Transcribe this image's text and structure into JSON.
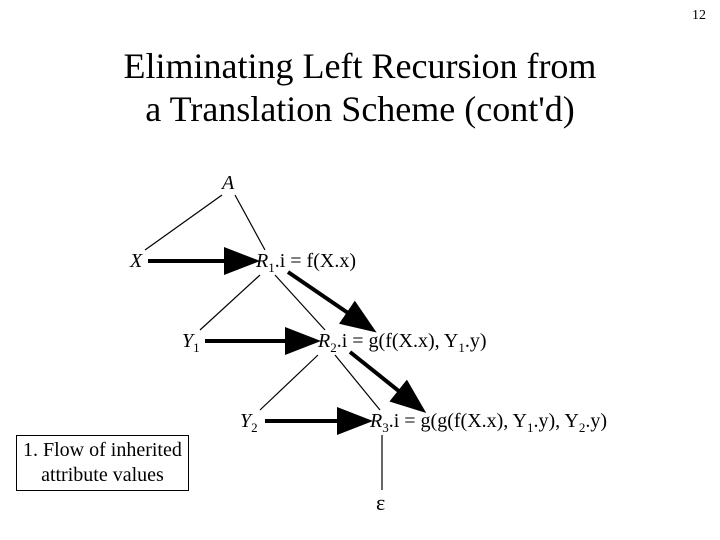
{
  "page_number": "12",
  "title_line1": "Eliminating Left Recursion from",
  "title_line2": "a Translation Scheme (cont'd)",
  "nodes": {
    "A": "A",
    "X": "X",
    "R1_prefix": "R",
    "R1_sub": "1",
    "R1_rest": ".i = f(X.x)",
    "Y1_prefix": "Y",
    "Y1_sub": "1",
    "R2_prefix": "R",
    "R2_sub": "2",
    "R2_mid1": ".i = g(f(X.x), Y",
    "R2_sub2": "1",
    "R2_rest": ".y)",
    "Y2_prefix": "Y",
    "Y2_sub": "2",
    "R3_prefix": "R",
    "R3_sub": "3",
    "R3_mid1": ".i = g(g(f(X.x), Y",
    "R3_sub2": "1",
    "R3_mid2": ".y), Y",
    "R3_sub3": "2",
    "R3_rest": ".y)",
    "epsilon": "ε"
  },
  "caption": {
    "line1": "1. Flow of inherited",
    "line2": "attribute values"
  }
}
